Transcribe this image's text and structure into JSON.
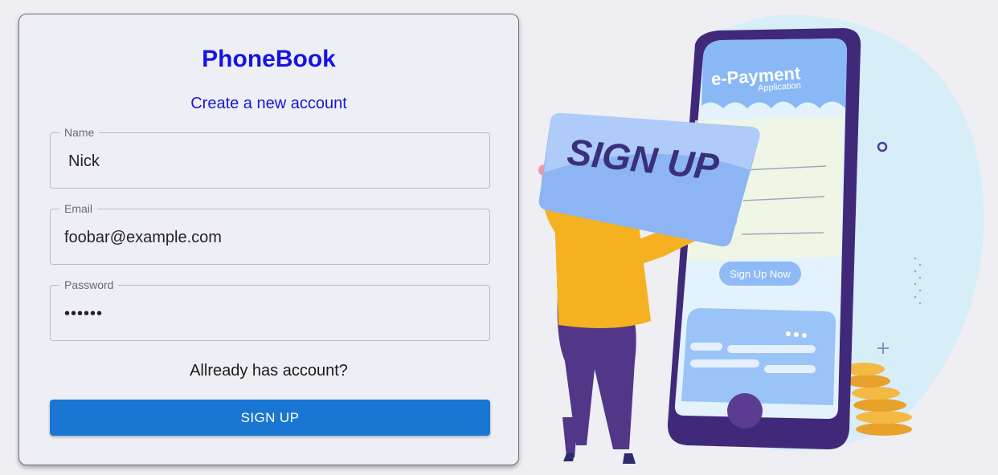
{
  "form": {
    "title": "PhoneBook",
    "subtitle": "Create a new account",
    "name": {
      "label": "Name",
      "value": "Nick"
    },
    "email": {
      "label": "Email",
      "value": "foobar@example.com"
    },
    "password": {
      "label": "Password",
      "value": "••••••"
    },
    "already_text": "Allready has account?",
    "submit_label": "SIGN UP"
  },
  "illustration": {
    "card_text": "SIGN UP",
    "app_title": "e-Payment",
    "app_subtitle": "Application",
    "cta": "Sign Up Now"
  },
  "colors": {
    "title": "#1414e6",
    "button": "#1976d2",
    "background": "#eeeef3"
  }
}
